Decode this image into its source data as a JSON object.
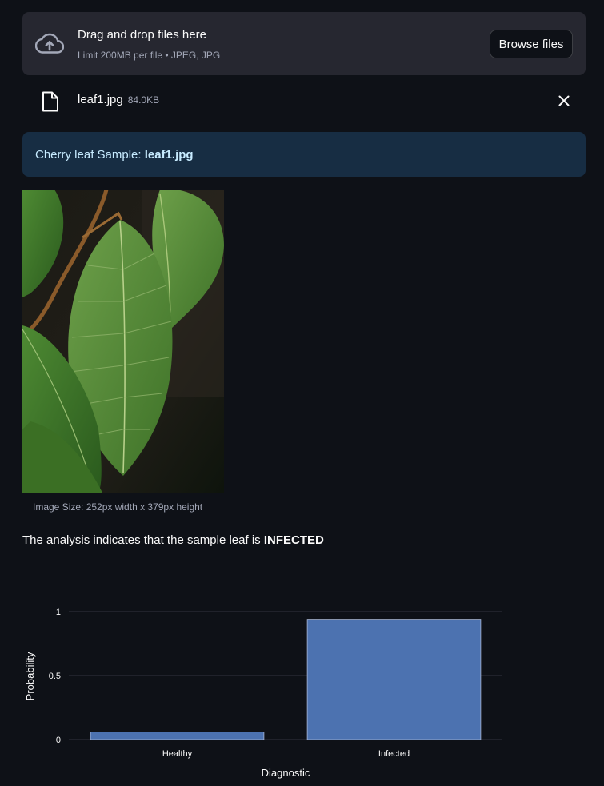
{
  "uploader": {
    "title": "Drag and drop files here",
    "limit_text": "Limit 200MB per file • JPEG, JPG",
    "browse_label": "Browse files",
    "icon": "cloud-upload-icon"
  },
  "file": {
    "name": "leaf1.jpg",
    "size": "84.0KB",
    "icon": "file-icon",
    "remove_icon": "close-icon"
  },
  "info": {
    "prefix": "Cherry leaf Sample: ",
    "filename": "leaf1.jpg"
  },
  "image": {
    "caption": "Image Size: 252px width x 379px height"
  },
  "result": {
    "prefix": "The analysis indicates that the sample leaf is ",
    "verdict": "INFECTED"
  },
  "colors": {
    "background": "#0e1117",
    "bar": "#4c72b0",
    "info_bg": "#172d43",
    "info_text": "#c7ebff"
  },
  "chart_data": {
    "type": "bar",
    "categories": [
      "Healthy",
      "Infected"
    ],
    "values": [
      0.06,
      0.94
    ],
    "xlabel": "Diagnostic",
    "ylabel": "Probability",
    "ylim": [
      0,
      1
    ],
    "yticks": [
      0,
      0.5,
      1
    ],
    "ytick_labels": [
      "0",
      "0.5",
      "1"
    ],
    "grid": true
  }
}
